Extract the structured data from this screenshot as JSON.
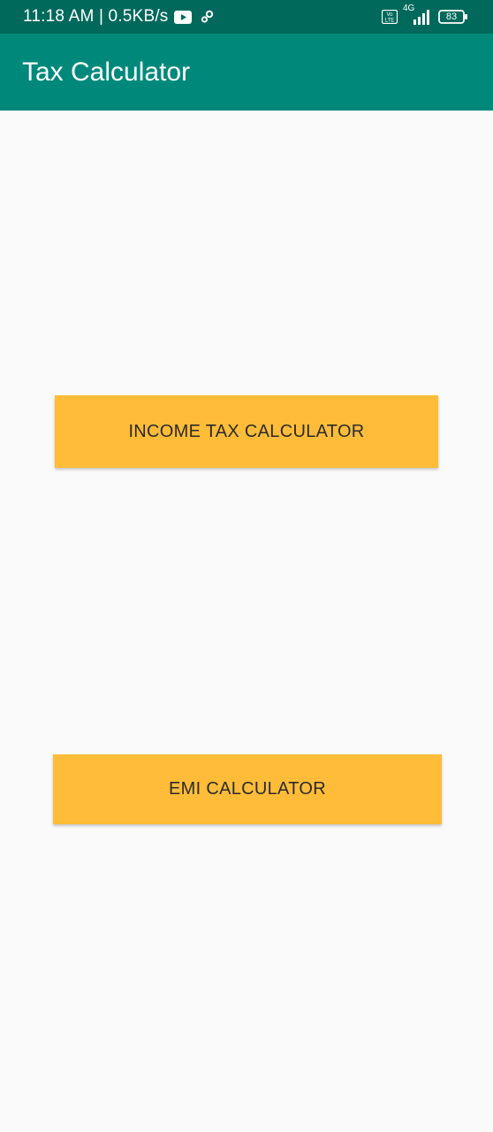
{
  "status_bar": {
    "time_speed": "11:18 AM | 0.5KB/s",
    "network_label": "4G",
    "volte_label": "Vo LTE",
    "battery_level": "83"
  },
  "app_bar": {
    "title": "Tax Calculator"
  },
  "main": {
    "income_tax_button_label": "INCOME TAX CALCULATOR",
    "emi_button_label": "EMI CALCULATOR"
  },
  "colors": {
    "status_bar": "#00695c",
    "app_bar": "#00897b",
    "button": "#ffbc38",
    "background": "#fafafa"
  },
  "icons": [
    "youtube-icon",
    "settings-sync-icon",
    "volte-icon",
    "signal-icon",
    "battery-icon"
  ]
}
